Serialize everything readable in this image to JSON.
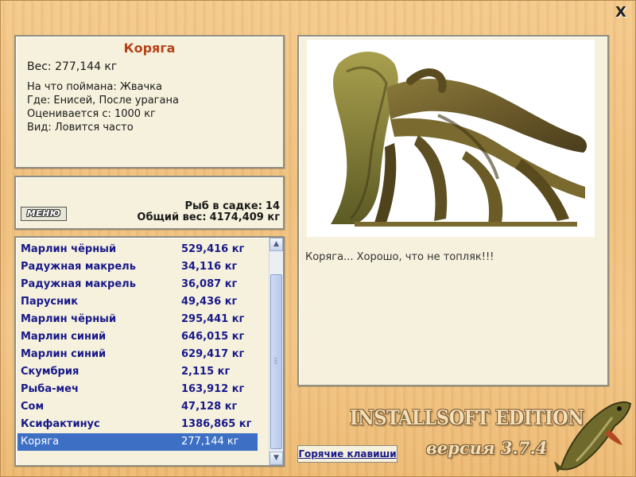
{
  "window": {
    "close_label": "X"
  },
  "info": {
    "title": "Коряга",
    "weight": "Вес: 277,144 кг",
    "details": [
      "На что поймана: Жвачка",
      "Где: Енисей, После урагана",
      "Оценивается с: 1000 кг",
      "Вид: Ловится часто"
    ]
  },
  "summary": {
    "menu_label": "МЕНЮ",
    "fish_count_label": "Рыб в садке:",
    "fish_count": "14",
    "total_weight_label": "Общий вес:",
    "total_weight": "4174,409 кг"
  },
  "catch_list": [
    {
      "name": "Марлин чёрный",
      "weight": "529,416 кг"
    },
    {
      "name": "Радужная макрель",
      "weight": "34,116 кг"
    },
    {
      "name": "Радужная макрель",
      "weight": "36,087 кг"
    },
    {
      "name": "Парусник",
      "weight": "49,436 кг"
    },
    {
      "name": "Марлин чёрный",
      "weight": "295,441 кг"
    },
    {
      "name": "Марлин синий",
      "weight": "646,015 кг"
    },
    {
      "name": "Марлин синий",
      "weight": "629,417 кг"
    },
    {
      "name": "Скумбрия",
      "weight": "2,115 кг"
    },
    {
      "name": "Рыба-меч",
      "weight": "163,912 кг"
    },
    {
      "name": "Сом",
      "weight": "47,128 кг"
    },
    {
      "name": "Ксифактинус",
      "weight": "1386,865 кг"
    },
    {
      "name": "Коряга",
      "weight": "277,144 кг",
      "selected": true
    }
  ],
  "viewer": {
    "caption": "Коряга... Хорошо, что не топляк!!!"
  },
  "footer": {
    "hotkeys_label": "Горячие клавиши",
    "brand": "INSTALLSOFT EDITION",
    "version": "версия 3.7.4"
  },
  "colors": {
    "background": "#f0c27f",
    "panel": "#f6f1dc",
    "title": "#b5431b",
    "list_text": "#18198a",
    "selection": "#3d6fc5"
  }
}
